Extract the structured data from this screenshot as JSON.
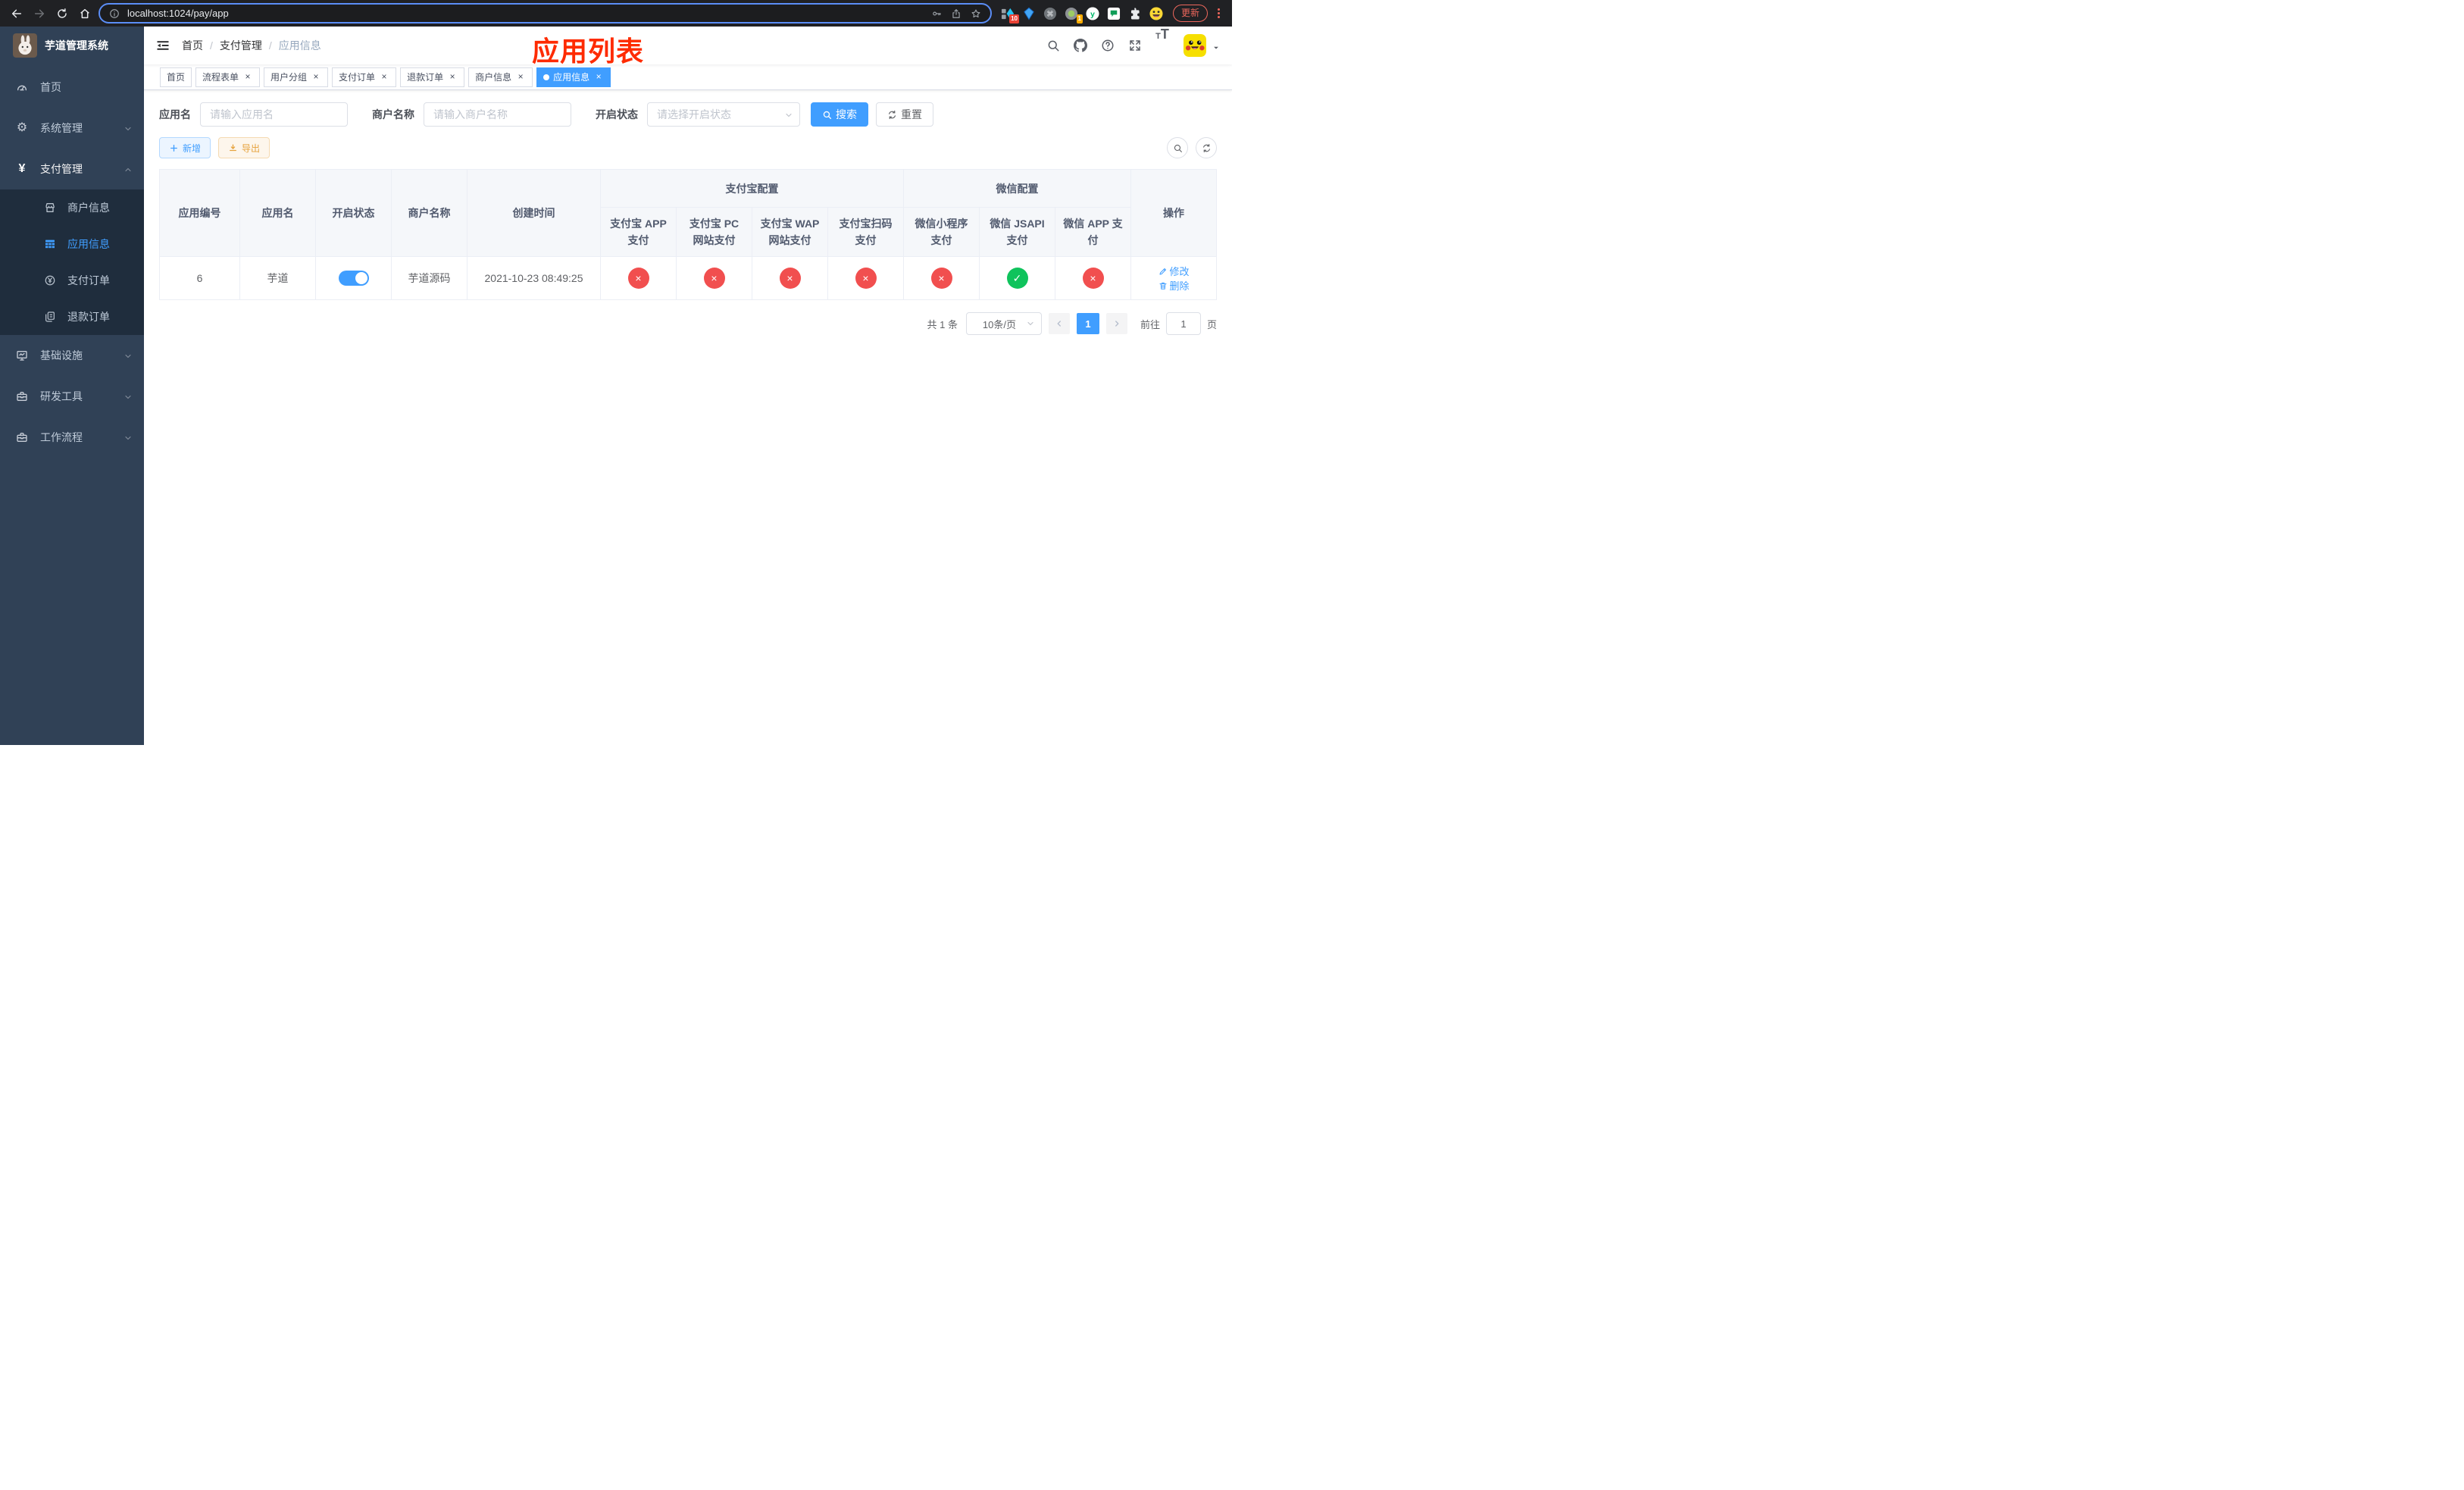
{
  "colors": {
    "accent": "#409eff",
    "danger": "#f14f4f",
    "success": "#0fc35c",
    "annotation_red": "#fe2b00",
    "sidebar_bg": "#304156",
    "submenu_bg": "#1f2d3d"
  },
  "browser": {
    "url": "localhost:1024/pay/app",
    "update_label": "更新",
    "ext_badge_blocks": "10",
    "ext_badge_recorder": "1"
  },
  "sidebar": {
    "title": "芋道管理系统",
    "items": {
      "home": "首页",
      "system": "系统管理",
      "pay": "支付管理",
      "merchant_info": "商户信息",
      "app_info": "应用信息",
      "pay_order": "支付订单",
      "refund_order": "退款订单",
      "infra": "基础设施",
      "dev_tools": "研发工具",
      "workflow": "工作流程"
    }
  },
  "navbar": {
    "breadcrumb": [
      "首页",
      "支付管理",
      "应用信息"
    ],
    "annotation": "应用列表"
  },
  "ui": {
    "close_glyph": "×",
    "breadcrumb_sep": "/"
  },
  "tabs": [
    {
      "label": "首页"
    },
    {
      "label": "流程表单"
    },
    {
      "label": "用户分组"
    },
    {
      "label": "支付订单"
    },
    {
      "label": "退款订单"
    },
    {
      "label": "商户信息"
    },
    {
      "label": "应用信息"
    }
  ],
  "filters": {
    "app_name": {
      "label": "应用名",
      "placeholder": "请输入应用名"
    },
    "merchant": {
      "label": "商户名称",
      "placeholder": "请输入商户名称"
    },
    "status": {
      "label": "开启状态",
      "placeholder": "请选择开启状态"
    },
    "search_label": "搜索",
    "reset_label": "重置"
  },
  "toolbar": {
    "add_label": "新增",
    "export_label": "导出"
  },
  "table": {
    "col_headers": [
      "应用编号",
      "应用名",
      "开启状态",
      "商户名称",
      "创建时间"
    ],
    "groups": {
      "alipay": "支付宝配置",
      "wechat": "微信配置"
    },
    "sub_headers": [
      "支付宝 APP 支付",
      "支付宝 PC 网站支付",
      "支付宝 WAP 网站支付",
      "支付宝扫码支付",
      "微信小程序支付",
      "微信 JSAPI 支付",
      "微信 APP 支付"
    ],
    "ops_header": "操作",
    "rows": [
      {
        "id": "6",
        "name": "芋道",
        "enabled": "true",
        "merchant": "芋道源码",
        "created": "2021-10-23 08:49:25",
        "statuses": [
          {
            "glyph": "×",
            "state": "off"
          },
          {
            "glyph": "×",
            "state": "off"
          },
          {
            "glyph": "×",
            "state": "off"
          },
          {
            "glyph": "×",
            "state": "off"
          },
          {
            "glyph": "×",
            "state": "off"
          },
          {
            "glyph": "✓",
            "state": "on"
          },
          {
            "glyph": "×",
            "state": "off"
          }
        ],
        "edit_label": "修改",
        "delete_label": "删除"
      }
    ]
  },
  "pagination": {
    "total_text": "共 1 条",
    "page_size": "10条/页",
    "current_page": "1",
    "goto_label": "前往",
    "goto_value": "1",
    "page_unit": "页"
  }
}
